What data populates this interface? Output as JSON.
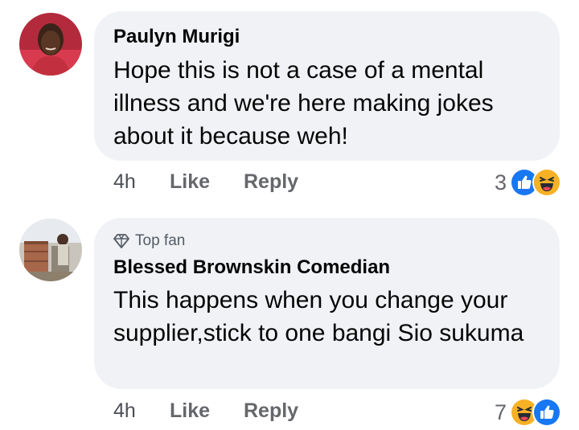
{
  "comments": [
    {
      "author": "Paulyn Murigi",
      "text": "Hope this is not a case of a mental illness and we're here making jokes about it because weh!",
      "time": "4h",
      "like_label": "Like",
      "reply_label": "Reply",
      "reaction_count": "3",
      "reactions": [
        "like-icon",
        "haha-icon"
      ]
    },
    {
      "badge": "Top fan",
      "badge_icon": "diamond-icon",
      "author": "Blessed Brownskin Comedian",
      "text": "This happens when you change your supplier,stick to one bangi Sio sukuma",
      "time": "4h",
      "like_label": "Like",
      "reply_label": "Reply",
      "reaction_count": "7",
      "reactions": [
        "haha-icon",
        "like-icon"
      ]
    }
  ],
  "colors": {
    "bubble": "#f0f2f5",
    "like_blue": "#1877f2",
    "haha_yellow": "#f7b125",
    "muted_text": "#65676b"
  }
}
